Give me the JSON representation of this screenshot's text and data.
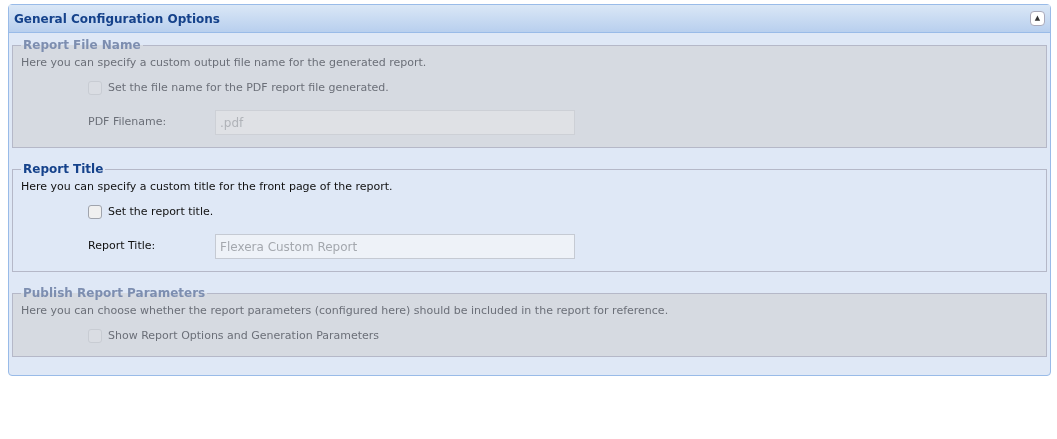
{
  "panel": {
    "title": "General Configuration Options",
    "collapse_button": "▲"
  },
  "sections": [
    {
      "legend": "Report File Name",
      "disabled": true,
      "description": "Here you can specify a custom output file name for the generated report.",
      "checkbox": {
        "label": "Set the file name for the PDF report file generated.",
        "checked": false
      },
      "field": {
        "label": "PDF Filename:",
        "placeholder": ".pdf"
      }
    },
    {
      "legend": "Report Title",
      "disabled": false,
      "description": "Here you can specify a custom title for the front page of the report.",
      "checkbox": {
        "label": "Set the report title.",
        "checked": false
      },
      "field": {
        "label": "Report Title:",
        "placeholder": "Flexera Custom Report"
      }
    },
    {
      "legend": "Publish Report Parameters",
      "disabled": true,
      "description": "Here you can choose whether the report parameters (configured here) should be included in the report for reference.",
      "checkbox": {
        "label": "Show Report Options and Generation Parameters",
        "checked": false
      }
    }
  ]
}
